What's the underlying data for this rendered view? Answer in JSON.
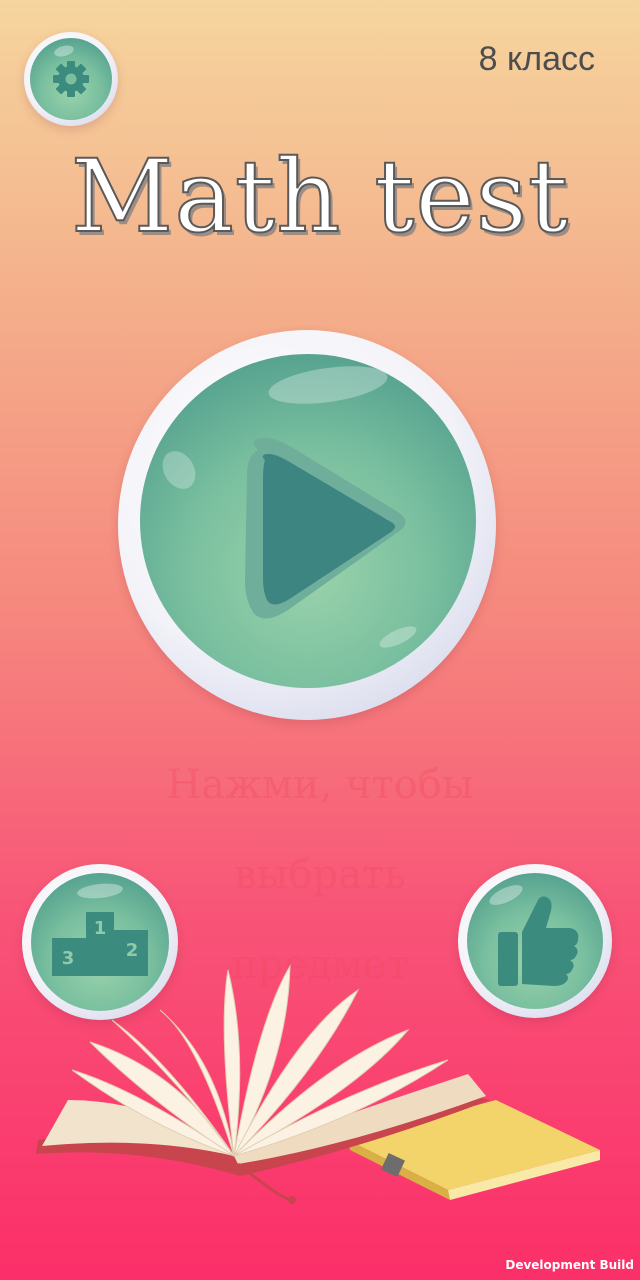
{
  "header": {
    "grade_label": "8 класс",
    "settings_icon": "gear-icon"
  },
  "title": "Math test",
  "play_button": {
    "icon": "play-icon"
  },
  "hint_lines": [
    "Нажми, чтобы",
    "выбрать",
    "предмет"
  ],
  "leaderboard_button": {
    "icon": "podium-icon",
    "places": [
      "1",
      "2",
      "3"
    ]
  },
  "rate_button": {
    "icon": "thumbs-up-icon"
  },
  "footer": {
    "dev_build_label": "Development Build"
  },
  "colors": {
    "accent": "#3d8a80",
    "bubble_light": "#9bd3ab",
    "background_top": "#f6d59e",
    "background_bottom": "#fb2f69"
  }
}
